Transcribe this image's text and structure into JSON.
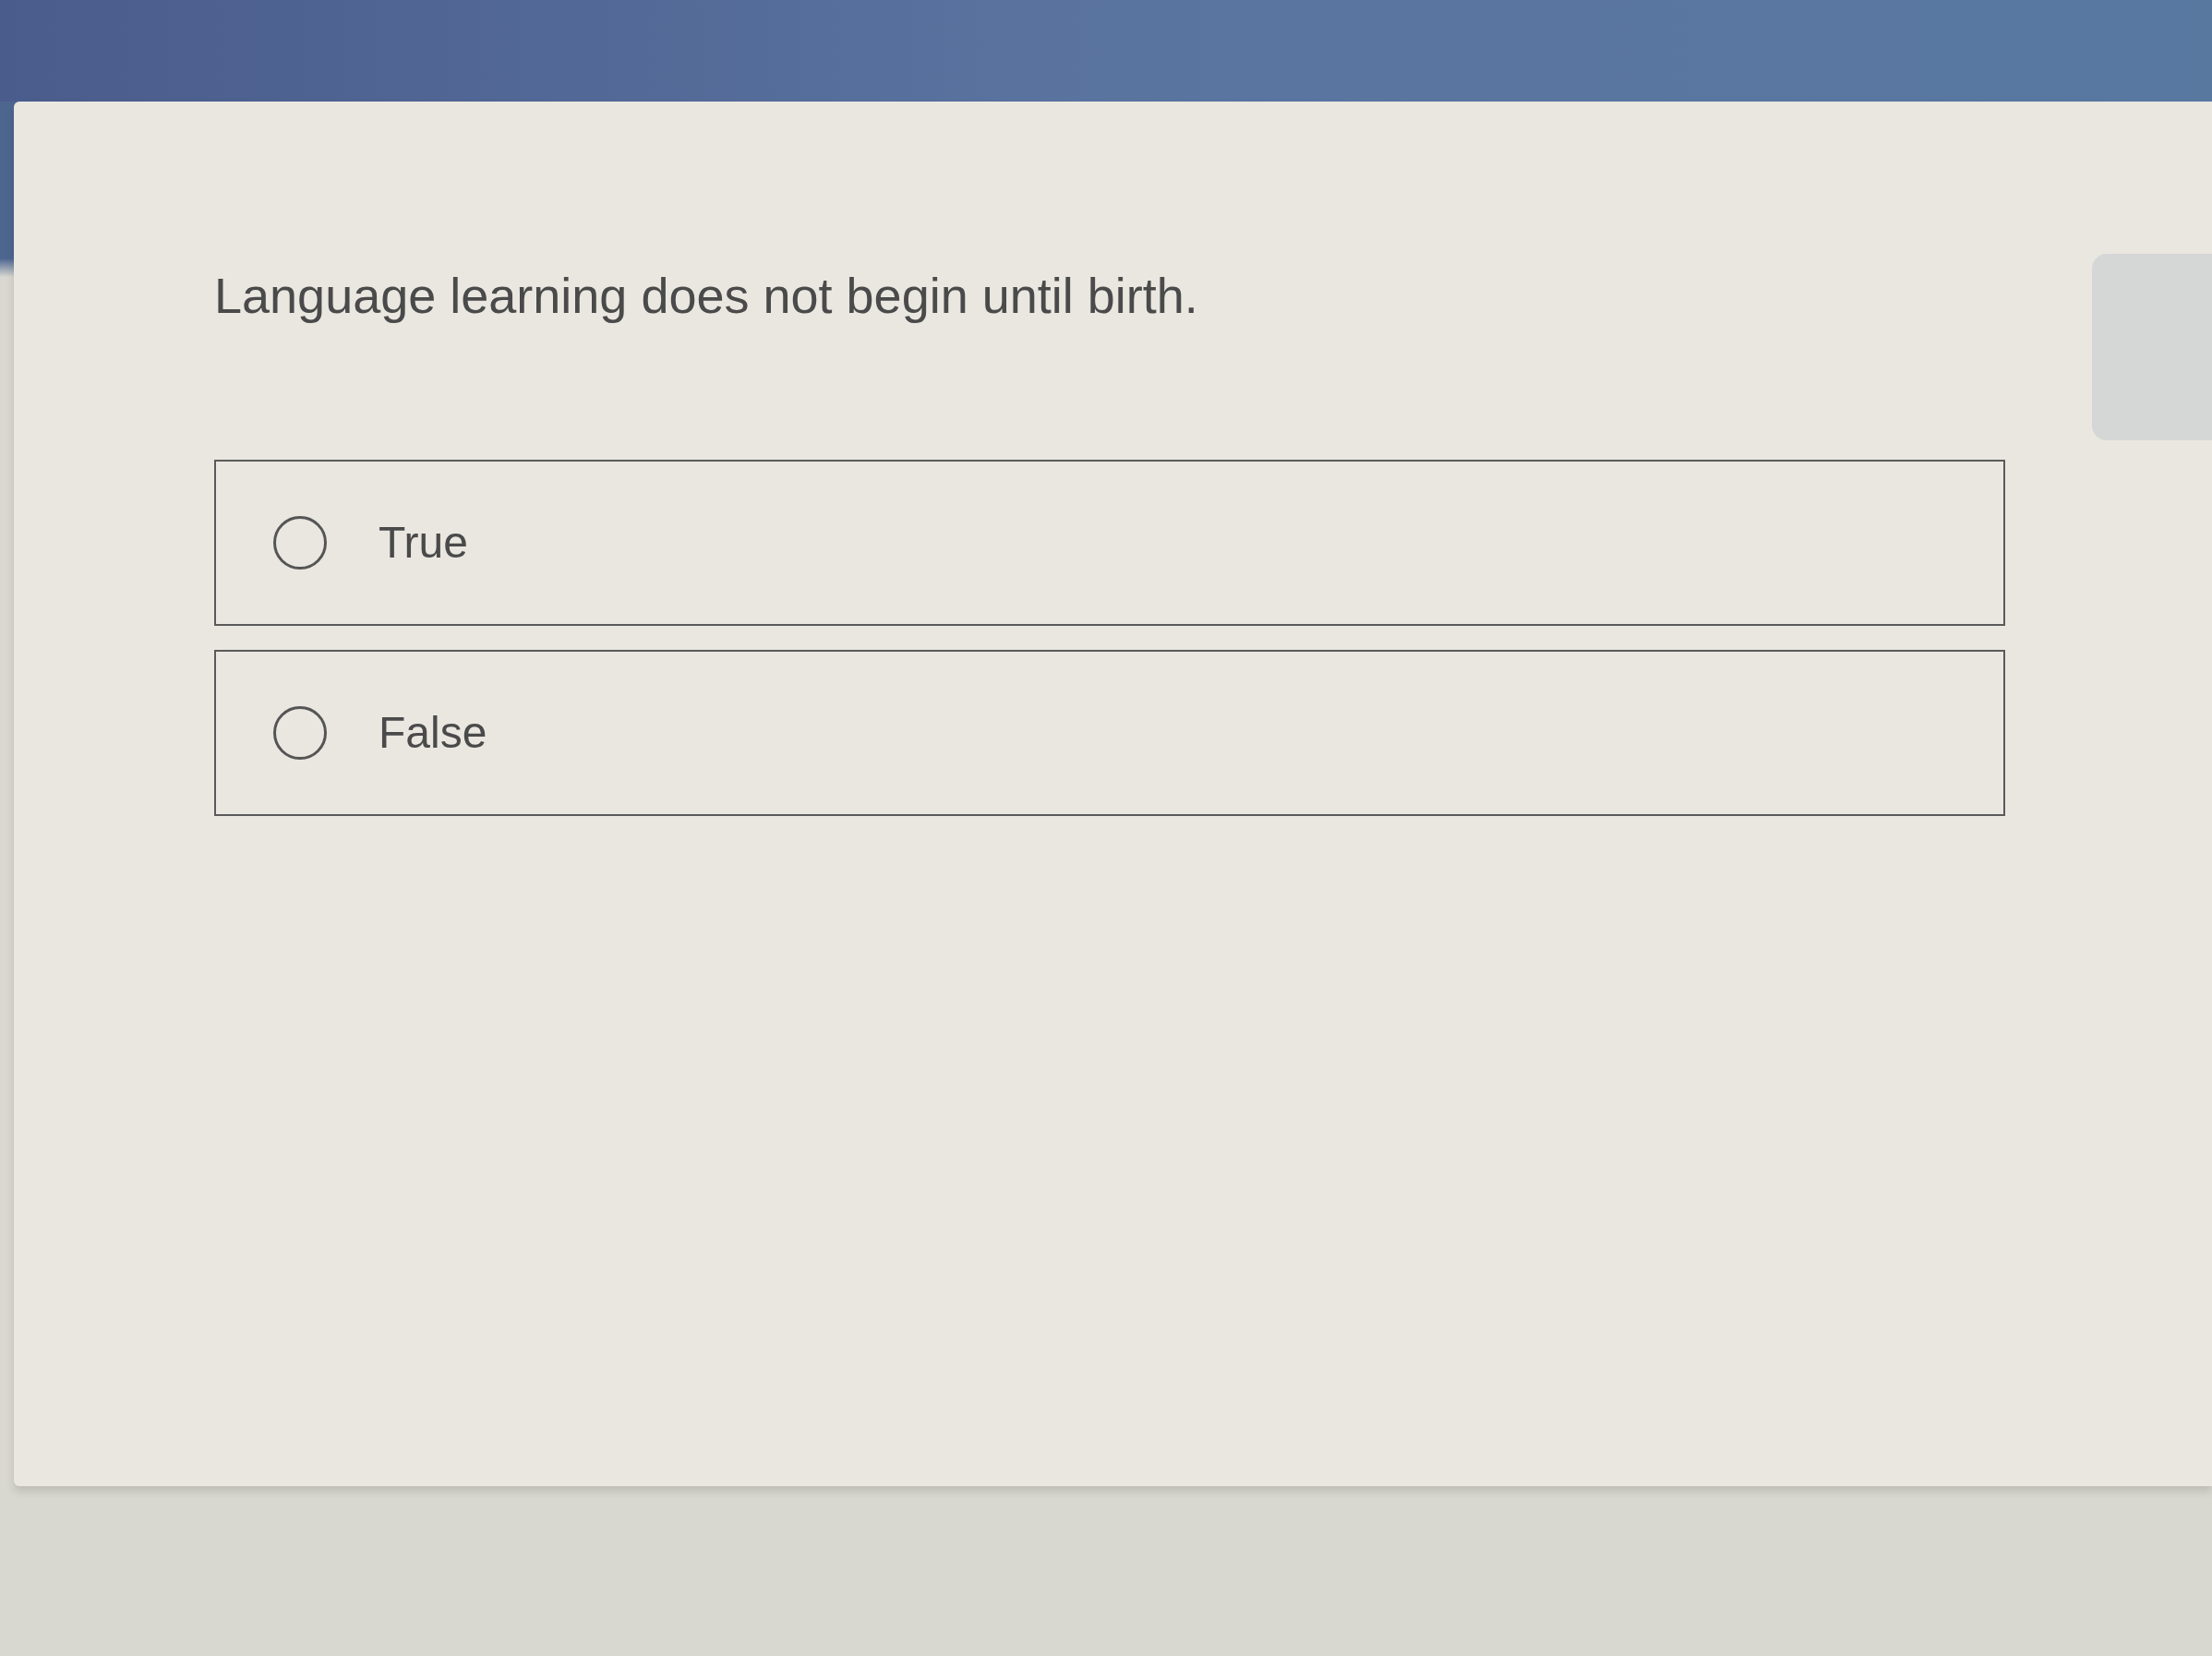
{
  "question": {
    "text": "Language learning does not begin until birth."
  },
  "options": [
    {
      "label": "True",
      "selected": false
    },
    {
      "label": "False",
      "selected": false
    }
  ]
}
